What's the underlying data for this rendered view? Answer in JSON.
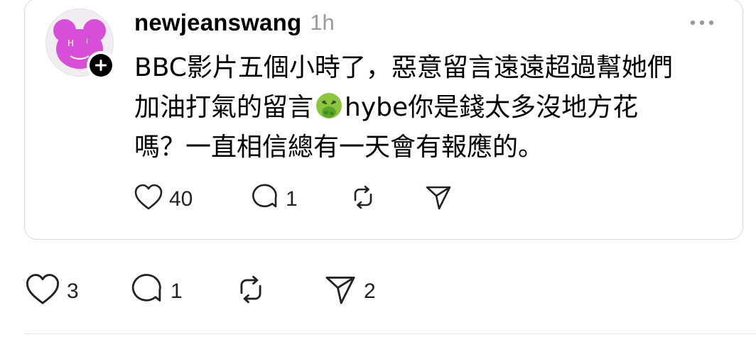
{
  "quoted_post": {
    "username": "newjeanswang",
    "time": "1h",
    "avatar_icon": "bear-avatar-icon",
    "follow_icon": "plus-icon",
    "text_lines": [
      "BBC影片五個小時了，惡意留言遠遠超過幫她們",
      "加油打氣的留言",
      "hybe你是錢太多沒地方花",
      "嗎？一直相信總有一天會有報應的。"
    ],
    "emoji": "nauseated-face-emoji",
    "actions": {
      "like_count": "40",
      "reply_count": "1"
    }
  },
  "post_actions": {
    "like_count": "3",
    "reply_count": "1",
    "share_count": "2"
  },
  "colors": {
    "avatar_pink": "#d84ed8",
    "muted_text": "#9a9a9a",
    "border": "#d9d9d9"
  }
}
